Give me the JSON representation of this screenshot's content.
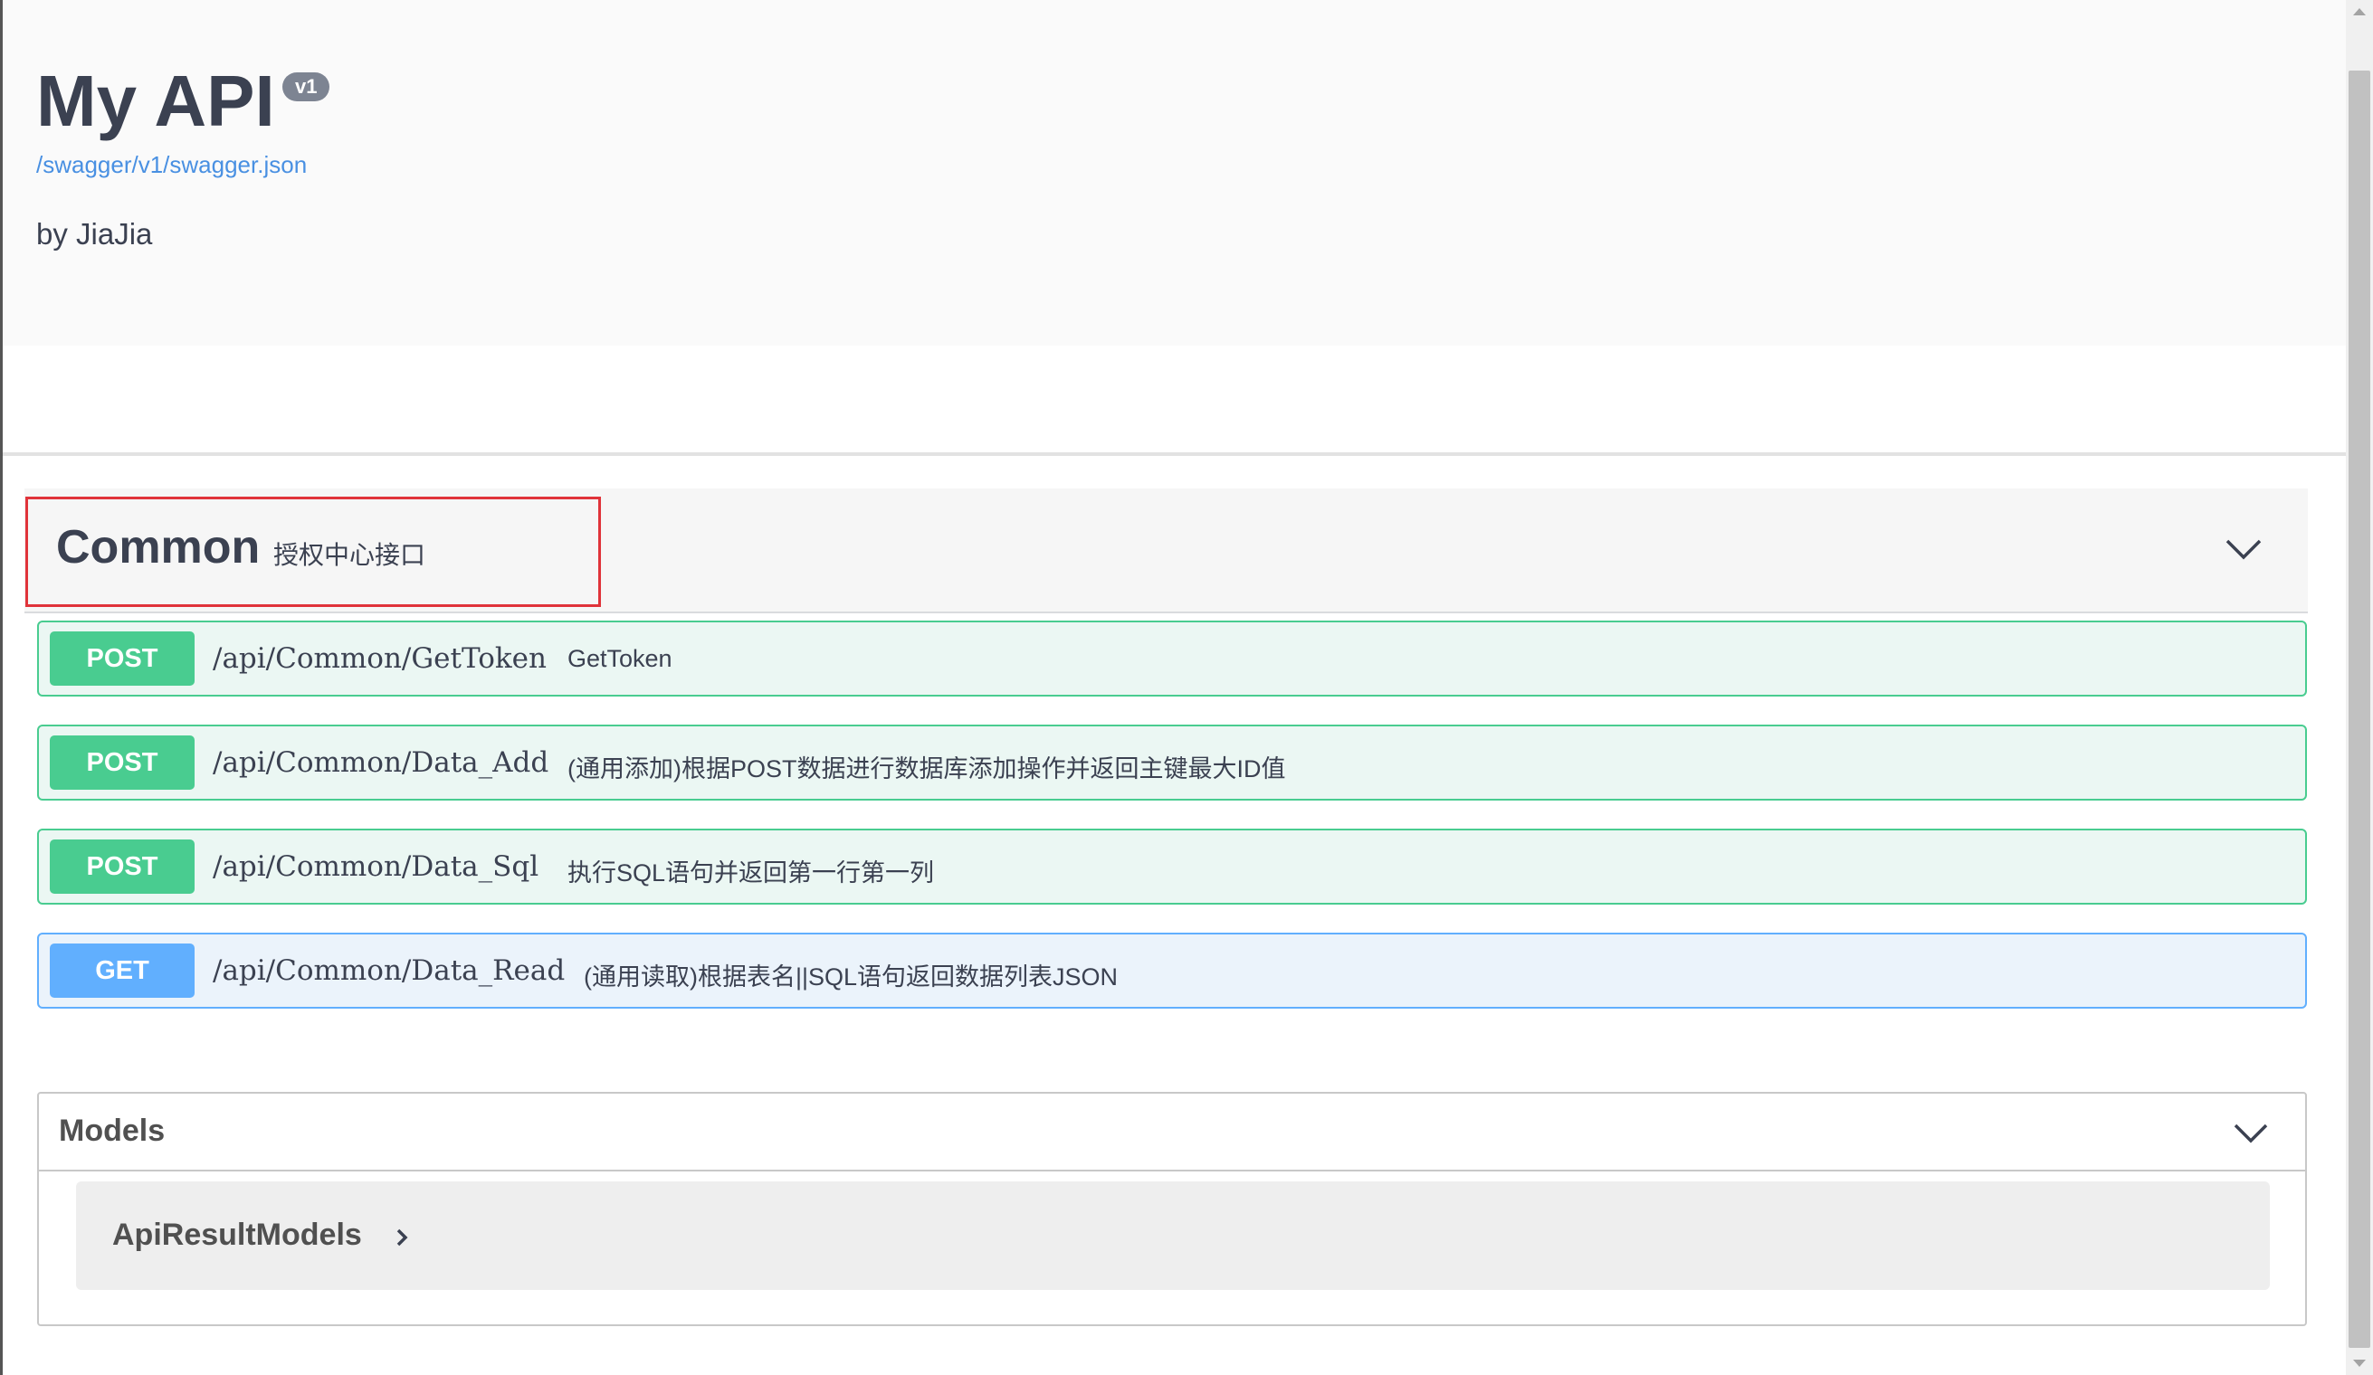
{
  "info": {
    "title": "My API",
    "version": "v1",
    "spec_link": "/swagger/v1/swagger.json",
    "description": "by JiaJia"
  },
  "tag": {
    "name": "Common",
    "description": "授权中心接口",
    "chevron_icon": "chevron-down-icon"
  },
  "operations": [
    {
      "method": "POST",
      "path": "/api/Common/GetToken",
      "summary": "GetToken"
    },
    {
      "method": "POST",
      "path": "/api/Common/Data_Add",
      "summary": "(通用添加)根据POST数据进行数据库添加操作并返回主键最大ID值"
    },
    {
      "method": "POST",
      "path": "/api/Common/Data_Sql",
      "summary": "执行SQL语句并返回第一行第一列"
    },
    {
      "method": "GET",
      "path": "/api/Common/Data_Read",
      "summary": "(通用读取)根据表名||SQL语句返回数据列表JSON"
    }
  ],
  "models": {
    "title": "Models",
    "items": [
      {
        "name": "ApiResultModels",
        "icon": "chevron-right-icon"
      }
    ]
  },
  "colors": {
    "post": "#49cc90",
    "get": "#61affe",
    "highlight": "#e0333a",
    "link": "#4990e2"
  }
}
